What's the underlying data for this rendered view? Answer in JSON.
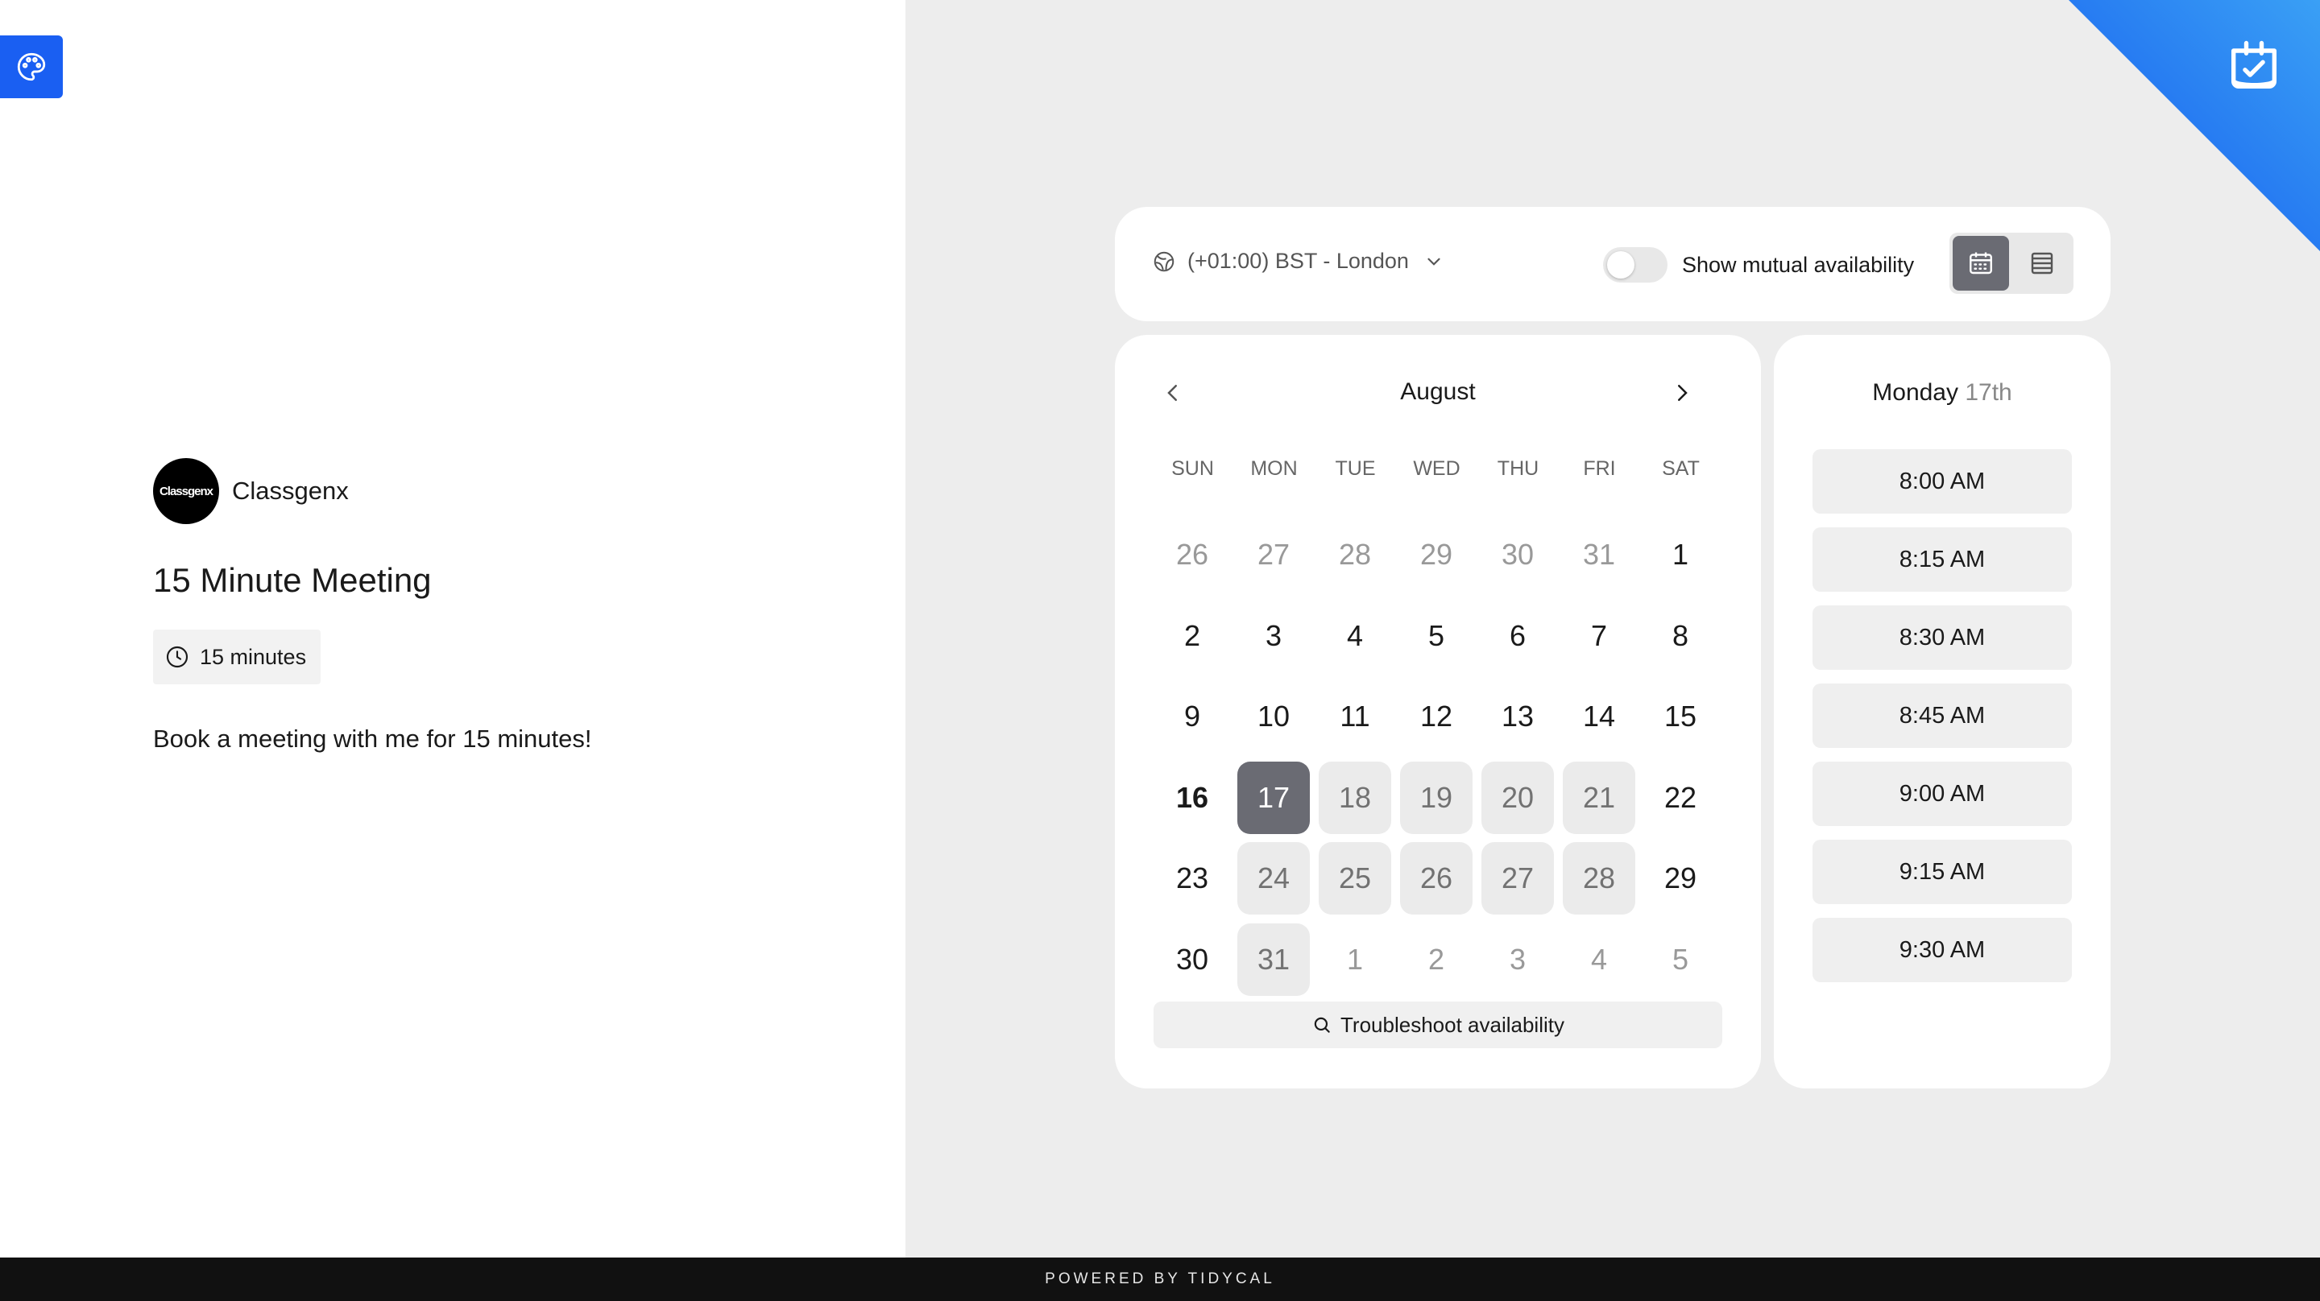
{
  "profile": {
    "avatar_text": "Classgenx",
    "org_name": "Classgenx"
  },
  "meeting": {
    "title": "15 Minute Meeting",
    "duration": "15 minutes",
    "description": "Book a meeting with me for 15 minutes!"
  },
  "timezone": {
    "label": "(+01:00) BST - London"
  },
  "mutual": {
    "label": "Show mutual availability",
    "enabled": false
  },
  "view_mode": {
    "selected": "calendar",
    "options": [
      "calendar",
      "list"
    ]
  },
  "calendar": {
    "month": "August",
    "weekdays": [
      "SUN",
      "MON",
      "TUE",
      "WED",
      "THU",
      "FRI",
      "SAT"
    ],
    "weeks": [
      [
        {
          "d": "26",
          "s": "muted"
        },
        {
          "d": "27",
          "s": "muted"
        },
        {
          "d": "28",
          "s": "muted"
        },
        {
          "d": "29",
          "s": "muted"
        },
        {
          "d": "30",
          "s": "muted"
        },
        {
          "d": "31",
          "s": "muted"
        },
        {
          "d": "1",
          "s": "normal"
        }
      ],
      [
        {
          "d": "2",
          "s": "normal"
        },
        {
          "d": "3",
          "s": "normal"
        },
        {
          "d": "4",
          "s": "normal"
        },
        {
          "d": "5",
          "s": "normal"
        },
        {
          "d": "6",
          "s": "normal"
        },
        {
          "d": "7",
          "s": "normal"
        },
        {
          "d": "8",
          "s": "normal"
        }
      ],
      [
        {
          "d": "9",
          "s": "normal"
        },
        {
          "d": "10",
          "s": "normal"
        },
        {
          "d": "11",
          "s": "normal"
        },
        {
          "d": "12",
          "s": "normal"
        },
        {
          "d": "13",
          "s": "normal"
        },
        {
          "d": "14",
          "s": "normal"
        },
        {
          "d": "15",
          "s": "normal"
        }
      ],
      [
        {
          "d": "16",
          "s": "today"
        },
        {
          "d": "17",
          "s": "selected"
        },
        {
          "d": "18",
          "s": "avail"
        },
        {
          "d": "19",
          "s": "avail"
        },
        {
          "d": "20",
          "s": "avail"
        },
        {
          "d": "21",
          "s": "avail"
        },
        {
          "d": "22",
          "s": "normal"
        }
      ],
      [
        {
          "d": "23",
          "s": "normal"
        },
        {
          "d": "24",
          "s": "avail"
        },
        {
          "d": "25",
          "s": "avail"
        },
        {
          "d": "26",
          "s": "avail"
        },
        {
          "d": "27",
          "s": "avail"
        },
        {
          "d": "28",
          "s": "avail"
        },
        {
          "d": "29",
          "s": "normal"
        }
      ],
      [
        {
          "d": "30",
          "s": "normal"
        },
        {
          "d": "31",
          "s": "avail"
        },
        {
          "d": "1",
          "s": "muted"
        },
        {
          "d": "2",
          "s": "muted"
        },
        {
          "d": "3",
          "s": "muted"
        },
        {
          "d": "4",
          "s": "muted"
        },
        {
          "d": "5",
          "s": "muted"
        }
      ]
    ],
    "troubleshoot_label": "Troubleshoot availability"
  },
  "slots": {
    "day": "Monday",
    "date_suffix": "17th",
    "times": [
      "8:00 AM",
      "8:15 AM",
      "8:30 AM",
      "8:45 AM",
      "9:00 AM",
      "9:15 AM",
      "9:30 AM"
    ]
  },
  "footer": {
    "text": "POWERED BY TIDYCAL"
  },
  "icons": {
    "theme": "palette-icon",
    "corner": "calendar-check-icon",
    "timezone": "globe-icon",
    "dropdown": "chevron-down-icon",
    "prev": "chevron-left-icon",
    "next": "chevron-right-icon",
    "duration": "clock-icon",
    "search": "search-icon"
  },
  "colors": {
    "accent_blue": "#1a5ff2",
    "selected_day": "#6a6b73",
    "available_day": "#ebebeb",
    "footer_bg": "#111111"
  }
}
